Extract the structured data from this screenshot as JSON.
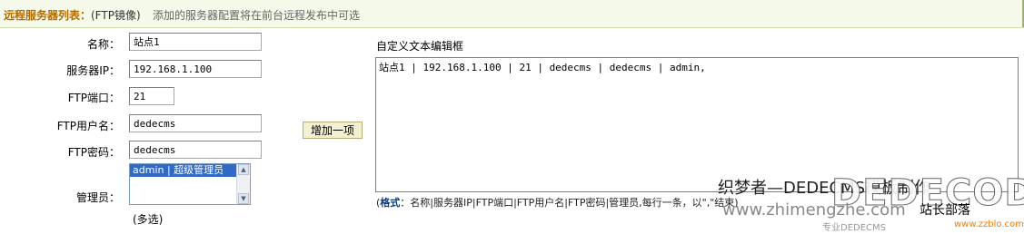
{
  "header": {
    "title": "远程服务器列表：",
    "subtitle": "(FTP镜像)",
    "description": "添加的服务器配置将在前台远程发布中可选"
  },
  "form": {
    "name": {
      "label": "名称：",
      "value": "站点1"
    },
    "server_ip": {
      "label": "服务器IP：",
      "value": "192.168.1.100"
    },
    "ftp_port": {
      "label": "FTP端口：",
      "value": "21"
    },
    "ftp_user": {
      "label": "FTP用户名：",
      "value": "dedecms"
    },
    "ftp_pass": {
      "label": "FTP密码：",
      "value": "dedecms"
    },
    "admin": {
      "label": "管理员：",
      "options": [
        "admin | 超级管理员"
      ],
      "hint": "(多选)"
    }
  },
  "add_button": "增加一项",
  "editor": {
    "title": "自定义文本编辑框",
    "content": "站点1 | 192.168.1.100 | 21 | dedecms | dedecms | admin,"
  },
  "format": {
    "label": "格式",
    "text": "：名称|服务器IP|FTP端口|FTP用户名|FTP密码|管理员,每行一条，以\",\"结束)"
  },
  "watermark": {
    "cn": "织梦者—DEDECMS模板制作",
    "big": "DEDECODE",
    "url": "www.zhimengzhe.com",
    "site": "站长部落",
    "foot": "专业DEDECMS",
    "zz": "www.zzblo.com"
  }
}
